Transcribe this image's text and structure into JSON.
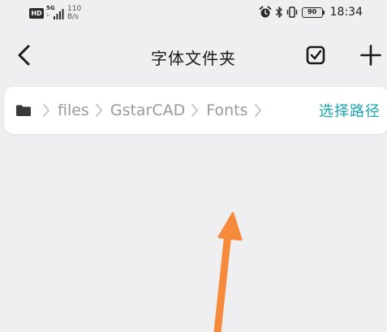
{
  "status_bar": {
    "hd_badge": "HD",
    "network_type": "5G",
    "network_sub": "1ı",
    "speed_value": "110",
    "speed_unit": "B/s",
    "battery": "90",
    "time": "18:34"
  },
  "header": {
    "title": "字体文件夹"
  },
  "breadcrumb": {
    "items": [
      "files",
      "GstarCAD",
      "Fonts"
    ],
    "select_path_label": "选择路径"
  },
  "colors": {
    "accent": "#1aa5b0",
    "background": "#efeff1",
    "annotation_arrow": "#f68a3c"
  },
  "icons": {
    "back": "chevron-left-icon",
    "multi_select": "checkbox-icon",
    "add": "plus-icon",
    "folder": "folder-icon",
    "separator": "chevron-right-icon"
  }
}
